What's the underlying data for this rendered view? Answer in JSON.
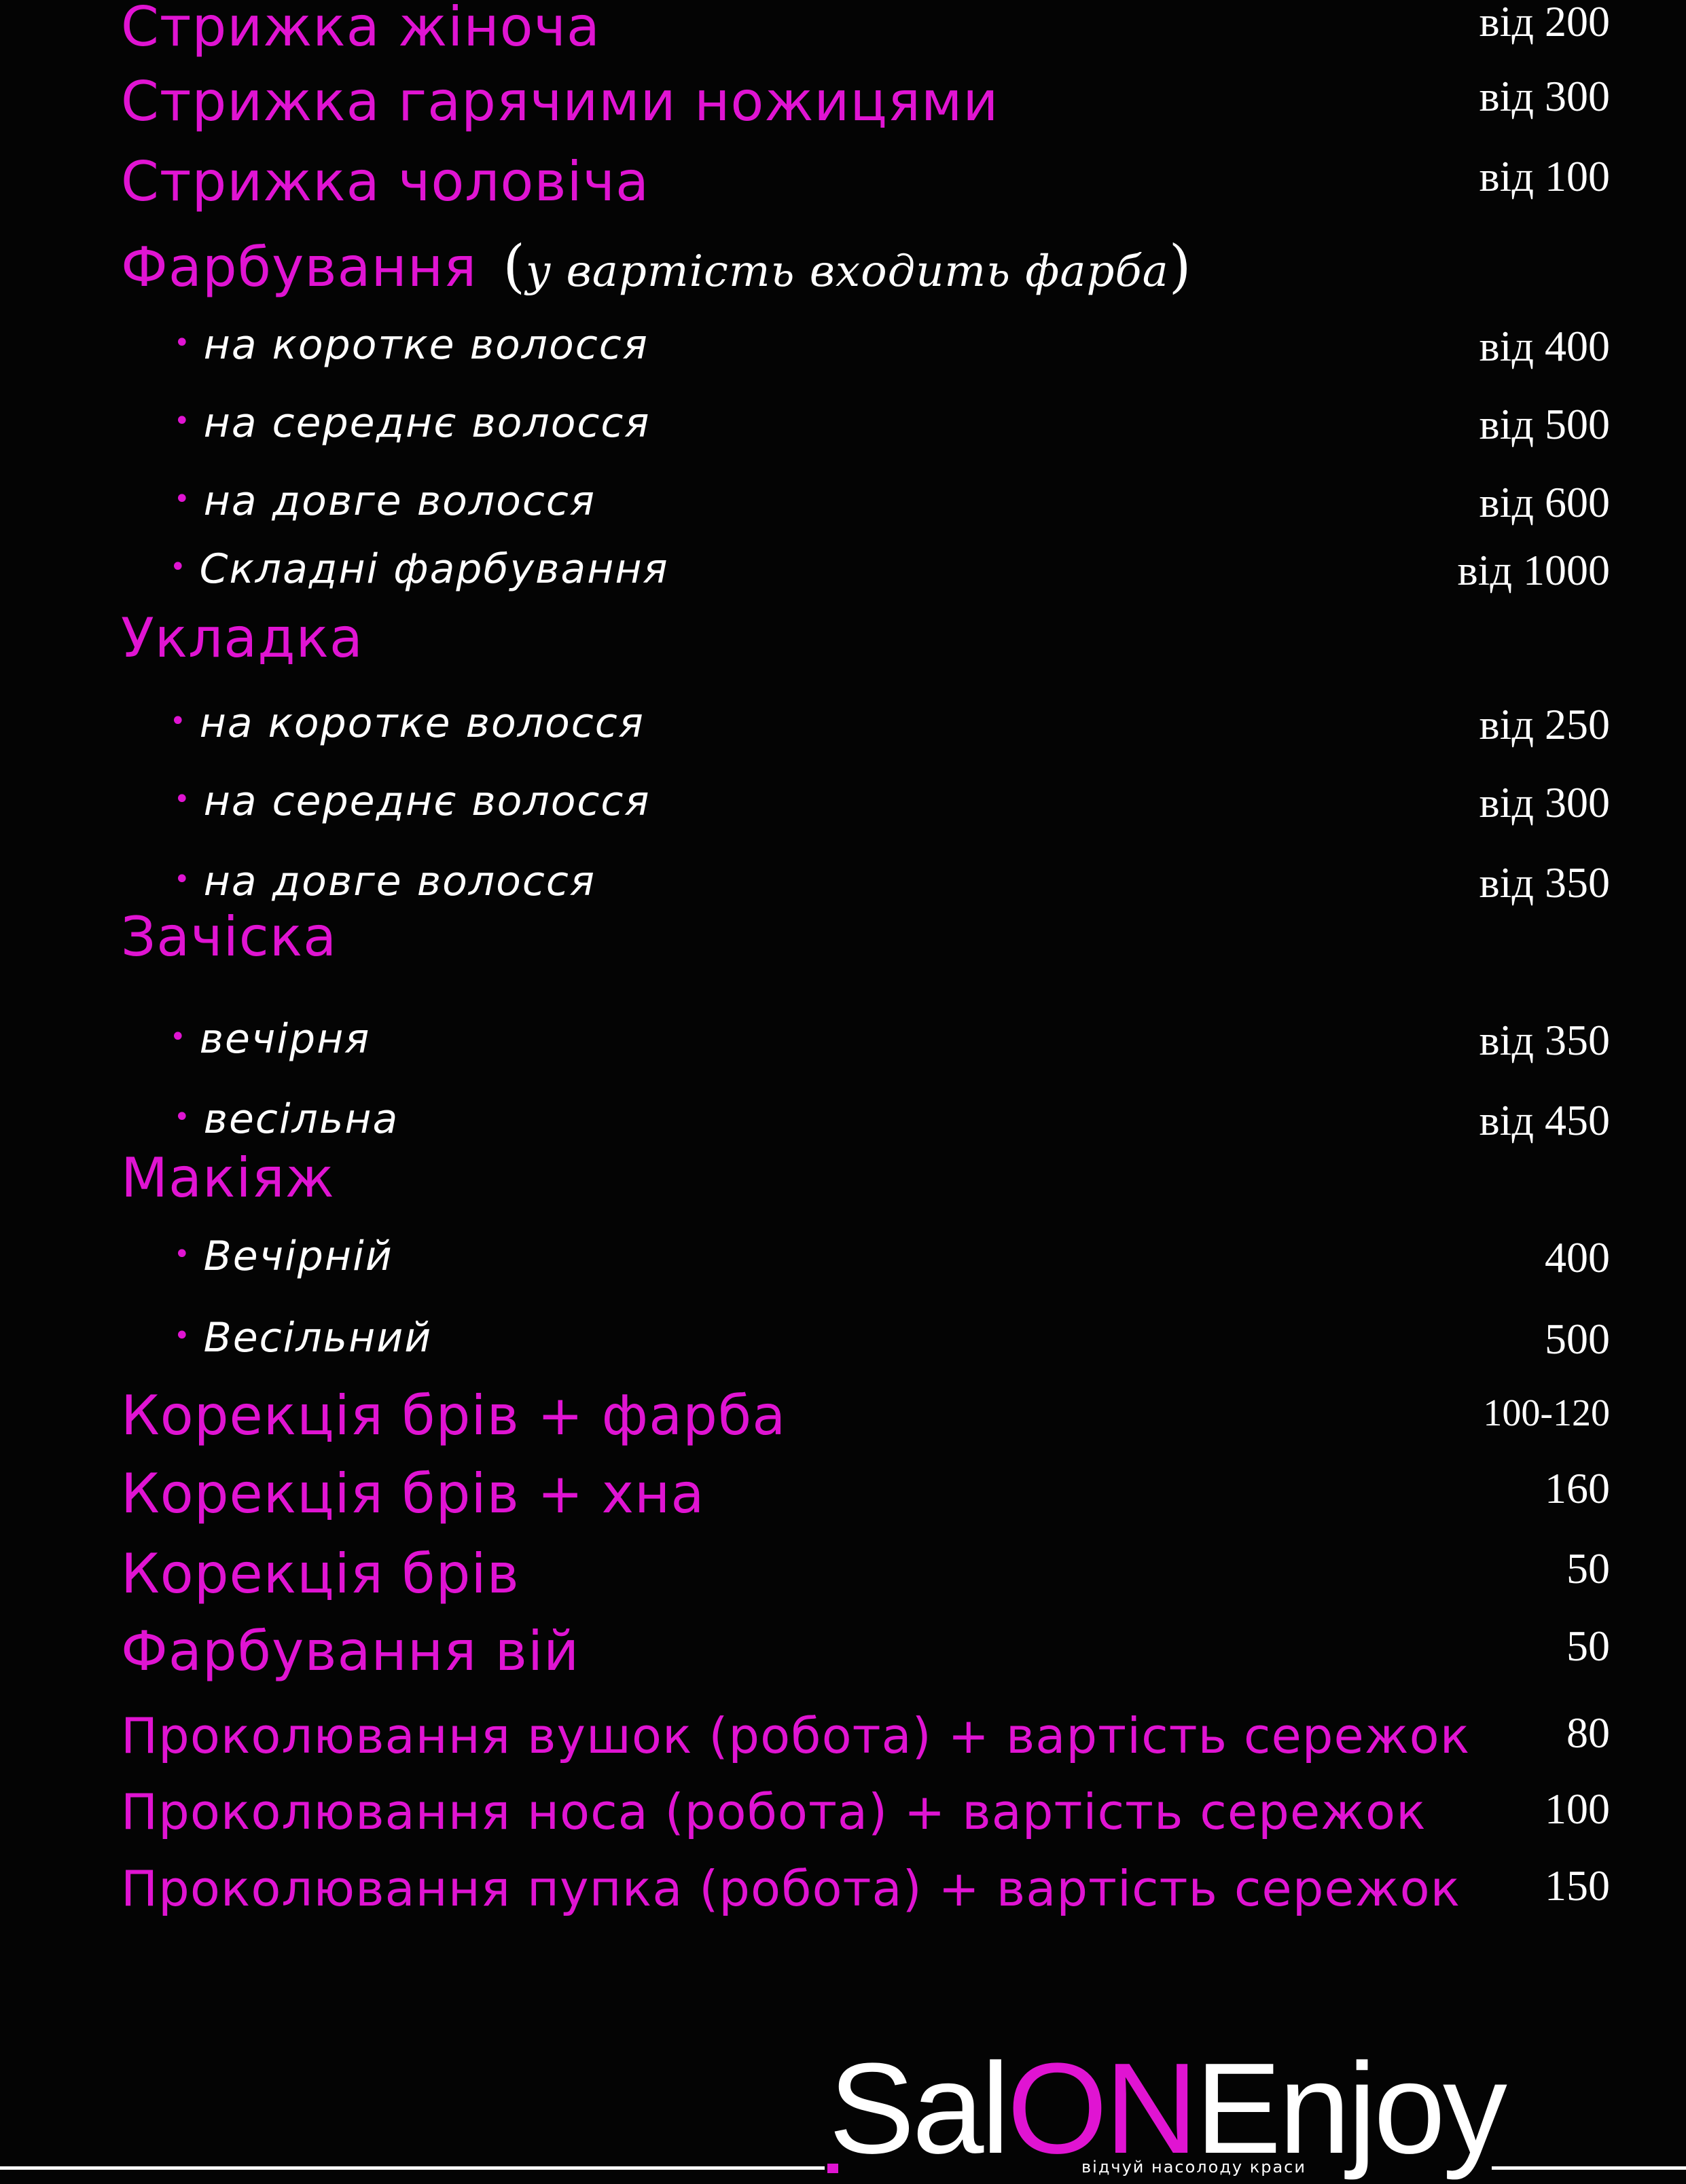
{
  "colors": {
    "background": "#040404",
    "accent": "#e014d2",
    "text": "#ffffff"
  },
  "menu": [
    {
      "type": "heading",
      "label": "Стрижка жіноча",
      "price": "від 200"
    },
    {
      "type": "heading",
      "label": "Стрижка гарячими ножицями",
      "price": "від 300"
    },
    {
      "type": "heading",
      "label": "Стрижка чоловіча",
      "price": "від 100"
    },
    {
      "type": "heading",
      "label": "Фарбування",
      "note": "у вартість входить фарба"
    },
    {
      "type": "sub",
      "label": "на коротке волосся",
      "price": "від 400"
    },
    {
      "type": "sub",
      "label": "на середнє волосся",
      "price": "від 500"
    },
    {
      "type": "sub",
      "label": "на довге волосся",
      "price": "від 600"
    },
    {
      "type": "sub",
      "label": "Складні фарбування",
      "price": "від 1000"
    },
    {
      "type": "heading",
      "label": "Укладка"
    },
    {
      "type": "sub",
      "label": "на коротке волосся",
      "price": "від 250"
    },
    {
      "type": "sub",
      "label": "на середнє волосся",
      "price": "від 300"
    },
    {
      "type": "sub",
      "label": "на довге волосся",
      "price": "від 350"
    },
    {
      "type": "heading",
      "label": "Зачіска"
    },
    {
      "type": "sub",
      "label": "вечірня",
      "price": "від 350"
    },
    {
      "type": "sub",
      "label": "весільна",
      "price": "від 450"
    },
    {
      "type": "heading",
      "label": "Макіяж"
    },
    {
      "type": "sub",
      "label": "Вечірній",
      "price": "400"
    },
    {
      "type": "sub",
      "label": "Весільний",
      "price": "500"
    },
    {
      "type": "heading",
      "label": "Корекція брів + фарба",
      "price": "100-120"
    },
    {
      "type": "heading",
      "label": "Корекція брів + хна",
      "price": "160"
    },
    {
      "type": "heading",
      "label": "Корекція брів",
      "price": "50"
    },
    {
      "type": "heading",
      "label": "Фарбування вій",
      "price": "50"
    },
    {
      "type": "long",
      "label": "Проколювання вушок (робота) + вартість сережок",
      "price": "80"
    },
    {
      "type": "long",
      "label": "Проколювання носа (робота) + вартість сережок",
      "price": "100"
    },
    {
      "type": "long",
      "label": "Проколювання пупка (робота) + вартість сережок",
      "price": "150"
    }
  ],
  "brand": {
    "logo_parts": [
      {
        "text": "Sal",
        "accent": false
      },
      {
        "text": "ON",
        "accent": true
      },
      {
        "text": "Enjoy",
        "accent": false
      }
    ],
    "tagline": "відчуй насолоду краси"
  }
}
